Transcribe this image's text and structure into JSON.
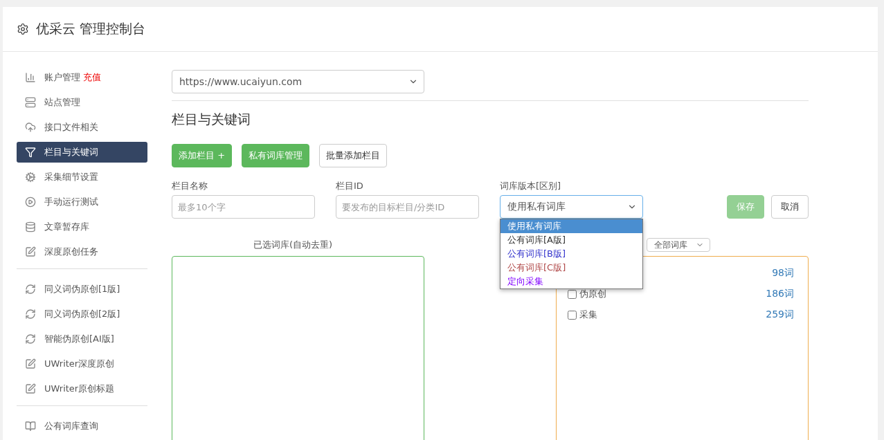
{
  "header": {
    "title": "优采云 管理控制台"
  },
  "sidebar": {
    "groups": [
      {
        "items": [
          {
            "label": "账户管理",
            "badge": "充值",
            "selected": false
          },
          {
            "label": "站点管理",
            "selected": false
          },
          {
            "label": "接口文件相关",
            "selected": false
          },
          {
            "label": "栏目与关键词",
            "selected": true
          },
          {
            "label": "采集细节设置",
            "selected": false
          },
          {
            "label": "手动运行测试",
            "selected": false
          },
          {
            "label": "文章暂存库",
            "selected": false
          },
          {
            "label": "深度原创任务",
            "selected": false
          }
        ]
      },
      {
        "items": [
          {
            "label": "同义词伪原创[1版]",
            "selected": false
          },
          {
            "label": "同义词伪原创[2版]",
            "selected": false
          },
          {
            "label": "智能伪原创[AI版]",
            "selected": false
          },
          {
            "label": "UWriter深度原创",
            "selected": false
          },
          {
            "label": "UWriter原创标题",
            "selected": false
          }
        ]
      },
      {
        "items": [
          {
            "label": "公有词库查询",
            "selected": false
          }
        ]
      }
    ]
  },
  "site_select": {
    "value": "https://www.ucaiyun.com"
  },
  "section_title": "栏目与关键词",
  "actions": [
    {
      "label": "添加栏目 +",
      "kind": "primary"
    },
    {
      "label": "私有词库管理",
      "kind": "primary"
    },
    {
      "label": "批量添加栏目",
      "kind": "default"
    }
  ],
  "form": {
    "name": {
      "label": "栏目名称",
      "placeholder": "最多10个字"
    },
    "id": {
      "label": "栏目ID",
      "placeholder": "要发布的目标栏目/分类ID"
    },
    "version": {
      "label": "词库版本[区别]",
      "value": "使用私有词库",
      "expanded": true,
      "options": [
        {
          "label": "使用私有词库",
          "selected": true
        },
        {
          "label": "公有词库[A版]",
          "selected": false,
          "color": "#333333"
        },
        {
          "label": "公有词库[B版]",
          "selected": false,
          "color": "#3333cc"
        },
        {
          "label": "公有词库[C版]",
          "selected": false,
          "color": "#b04848"
        },
        {
          "label": "定向采集",
          "selected": false,
          "color": "#8000ff"
        }
      ]
    },
    "save": {
      "label": "保存",
      "disabled": true
    },
    "cancel": {
      "label": "取消"
    }
  },
  "selected_label": "已选词库(自动去重)",
  "filter_select": {
    "value": "全部词库"
  },
  "library_rows": [
    {
      "count": "98词"
    },
    {
      "name": "伪原创",
      "count": "186词",
      "checked": false
    },
    {
      "name": "采集",
      "count": "259词",
      "checked": false
    }
  ]
}
